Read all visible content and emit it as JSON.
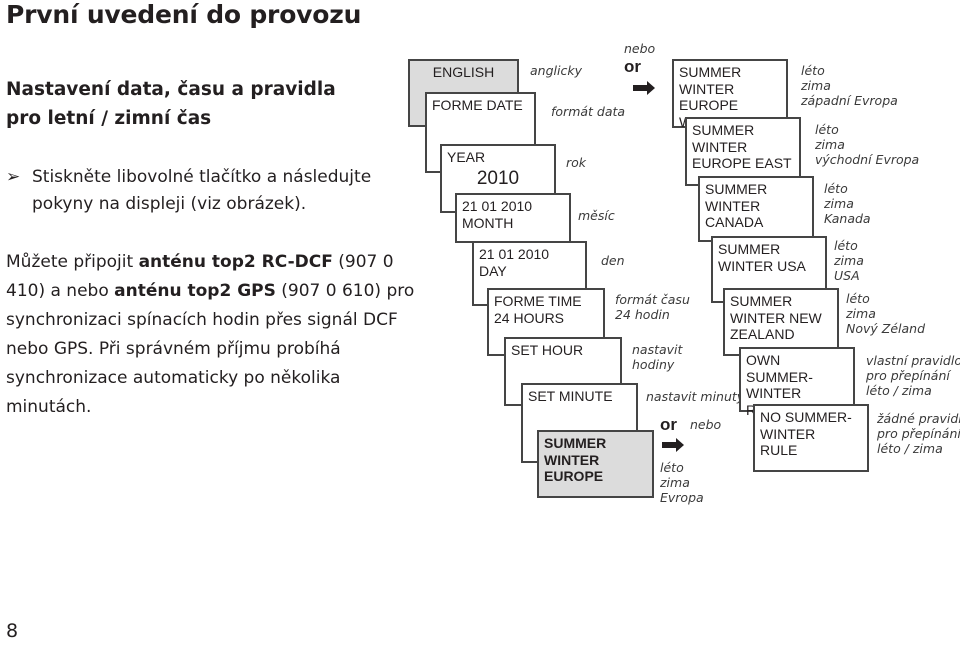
{
  "page": {
    "title": "První uvedení do provozu",
    "section_title_lines": [
      "Nastavení data, času a pravidla",
      "pro letní / zimní čas"
    ],
    "bullet_marker": "➢",
    "bullet_text": "Stiskněte libovolné tlačítko a následujte pokyny na displeji (viz obrázek).",
    "paragraph": {
      "p1": "Můžete připojit ",
      "b1": "anténu top2 RC-DCF",
      "p2": " (907 0 410) a nebo ",
      "b2": "anténu top2 GPS",
      "p3": " (907 0 610) pro synchronizaci spínacích hodin přes signál DCF nebo GPS. Při správném příjmu probíhá synchronizace automaticky po několika minutách."
    },
    "page_number": "8"
  },
  "diagram": {
    "main_sequence": [
      {
        "lines": [
          "ENGLISH"
        ],
        "label": [
          "anglicky"
        ],
        "highlight": true
      },
      {
        "lines": [
          "FORME DATE"
        ],
        "label": [
          "formát data"
        ]
      },
      {
        "lines": [
          "YEAR",
          "2010"
        ],
        "label": [
          "rok"
        ]
      },
      {
        "lines": [
          "21 01 2010",
          "MONTH"
        ],
        "label": [
          "měsíc"
        ]
      },
      {
        "lines": [
          "21 01 2010",
          "DAY"
        ],
        "label": [
          "den"
        ]
      },
      {
        "lines": [
          "FORME TIME",
          "24 HOURS"
        ],
        "label": [
          "formát času",
          "24 hodin"
        ]
      },
      {
        "lines": [
          "SET HOUR"
        ],
        "label": [
          "nastavit",
          "hodiny"
        ]
      },
      {
        "lines": [
          "SET MINUTE"
        ],
        "label": [
          "nastavit minuty"
        ]
      },
      {
        "lines": [
          "SUMMER",
          "WINTER",
          "EUROPE"
        ],
        "label": [
          "léto",
          "zima",
          "Evropa"
        ],
        "highlight": true
      }
    ],
    "or_top": {
      "word_cs": "nebo",
      "word_en": "or"
    },
    "or_bottom": {
      "word_cs": "nebo",
      "word_en": "or"
    },
    "alternatives": [
      {
        "lines": [
          "SUMMER",
          "WINTER",
          "EUROPE WEST"
        ],
        "label": [
          "léto",
          "zima",
          "západní Evropa"
        ]
      },
      {
        "lines": [
          "SUMMER",
          "WINTER",
          "EUROPE EAST"
        ],
        "label": [
          "léto",
          "zima",
          "východní Evropa"
        ]
      },
      {
        "lines": [
          "SUMMER",
          "WINTER",
          "CANADA"
        ],
        "label": [
          "léto",
          "zima",
          "Kanada"
        ]
      },
      {
        "lines": [
          "SUMMER",
          "WINTER USA"
        ],
        "label": [
          "léto",
          "zima",
          "USA"
        ]
      },
      {
        "lines": [
          "SUMMER",
          "WINTER NEW",
          "ZEALAND"
        ],
        "label": [
          "léto",
          "zima",
          "Nový Zéland"
        ]
      },
      {
        "lines": [
          "OWN SUMMER-",
          "WINTER",
          "RULE"
        ],
        "label": [
          "vlastní pravidlo",
          "pro přepínání",
          "léto / zima"
        ]
      },
      {
        "lines": [
          "NO SUMMER-",
          "WINTER",
          "RULE"
        ],
        "label": [
          "žádné pravidlo",
          "pro přepínání",
          "léto / zima"
        ]
      }
    ]
  }
}
